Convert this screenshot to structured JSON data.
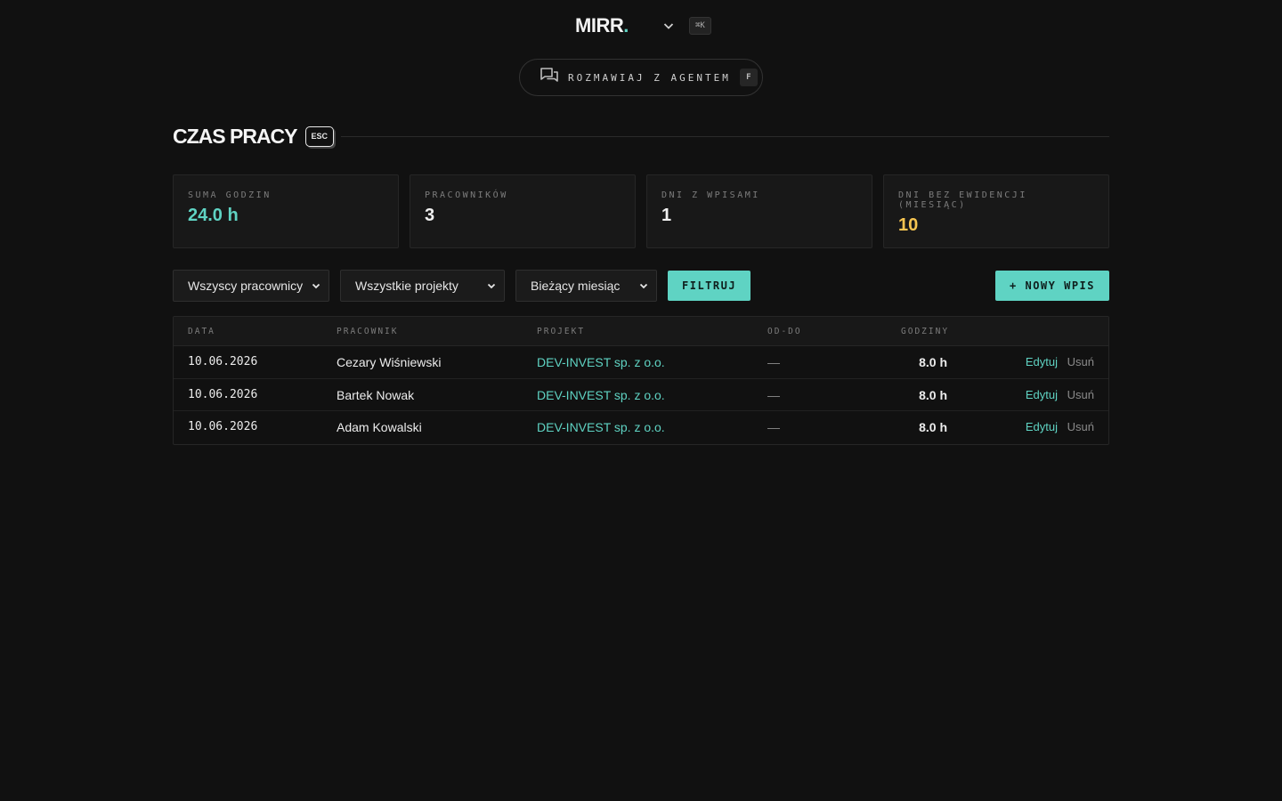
{
  "brand": {
    "name": "MIRR",
    "dot": ".",
    "shortcut": "⌘K"
  },
  "agent": {
    "label": "ROZMAWIAJ Z AGENTEM",
    "shortcut": "F"
  },
  "section": {
    "title": "CZAS PRACY",
    "esc_label": "ESC"
  },
  "stats": [
    {
      "label": "SUMA GODZIN",
      "value": "24.0 h"
    },
    {
      "label": "PRACOWNIKÓW",
      "value": "3"
    },
    {
      "label": "DNI Z WPISAMI",
      "value": "1"
    },
    {
      "label": "DNI BEZ EWIDENCJI (MIESIĄC)",
      "value": "10"
    }
  ],
  "filters": {
    "employee": "Wszyscy pracownicy",
    "project": "Wszystkie projekty",
    "period": "Bieżący miesiąc",
    "filter_button": "FILTRUJ",
    "new_button": "+ NOWY WPIS"
  },
  "table": {
    "headers": [
      "DATA",
      "PRACOWNIK",
      "PROJEKT",
      "OD-DO",
      "GODZINY"
    ],
    "rows": [
      {
        "date": "10.06.2026",
        "employee": "Cezary Wiśniewski",
        "project": "DEV-INVEST sp. z o.o.",
        "range": "—",
        "hours": "8.0 h",
        "edit": "Edytuj",
        "delete": "Usuń"
      },
      {
        "date": "10.06.2026",
        "employee": "Bartek Nowak",
        "project": "DEV-INVEST sp. z o.o.",
        "range": "—",
        "hours": "8.0 h",
        "edit": "Edytuj",
        "delete": "Usuń"
      },
      {
        "date": "10.06.2026",
        "employee": "Adam Kowalski",
        "project": "DEV-INVEST sp. z o.o.",
        "range": "—",
        "hours": "8.0 h",
        "edit": "Edytuj",
        "delete": "Usuń"
      }
    ]
  },
  "colors": {
    "accent": "#5fd3c3",
    "warning": "#f5c451",
    "background": "#111111"
  },
  "icons": {
    "brand_menu": "chevron-down-icon",
    "agent": "chat-bubbles-icon",
    "select": "chevron-down-icon"
  }
}
